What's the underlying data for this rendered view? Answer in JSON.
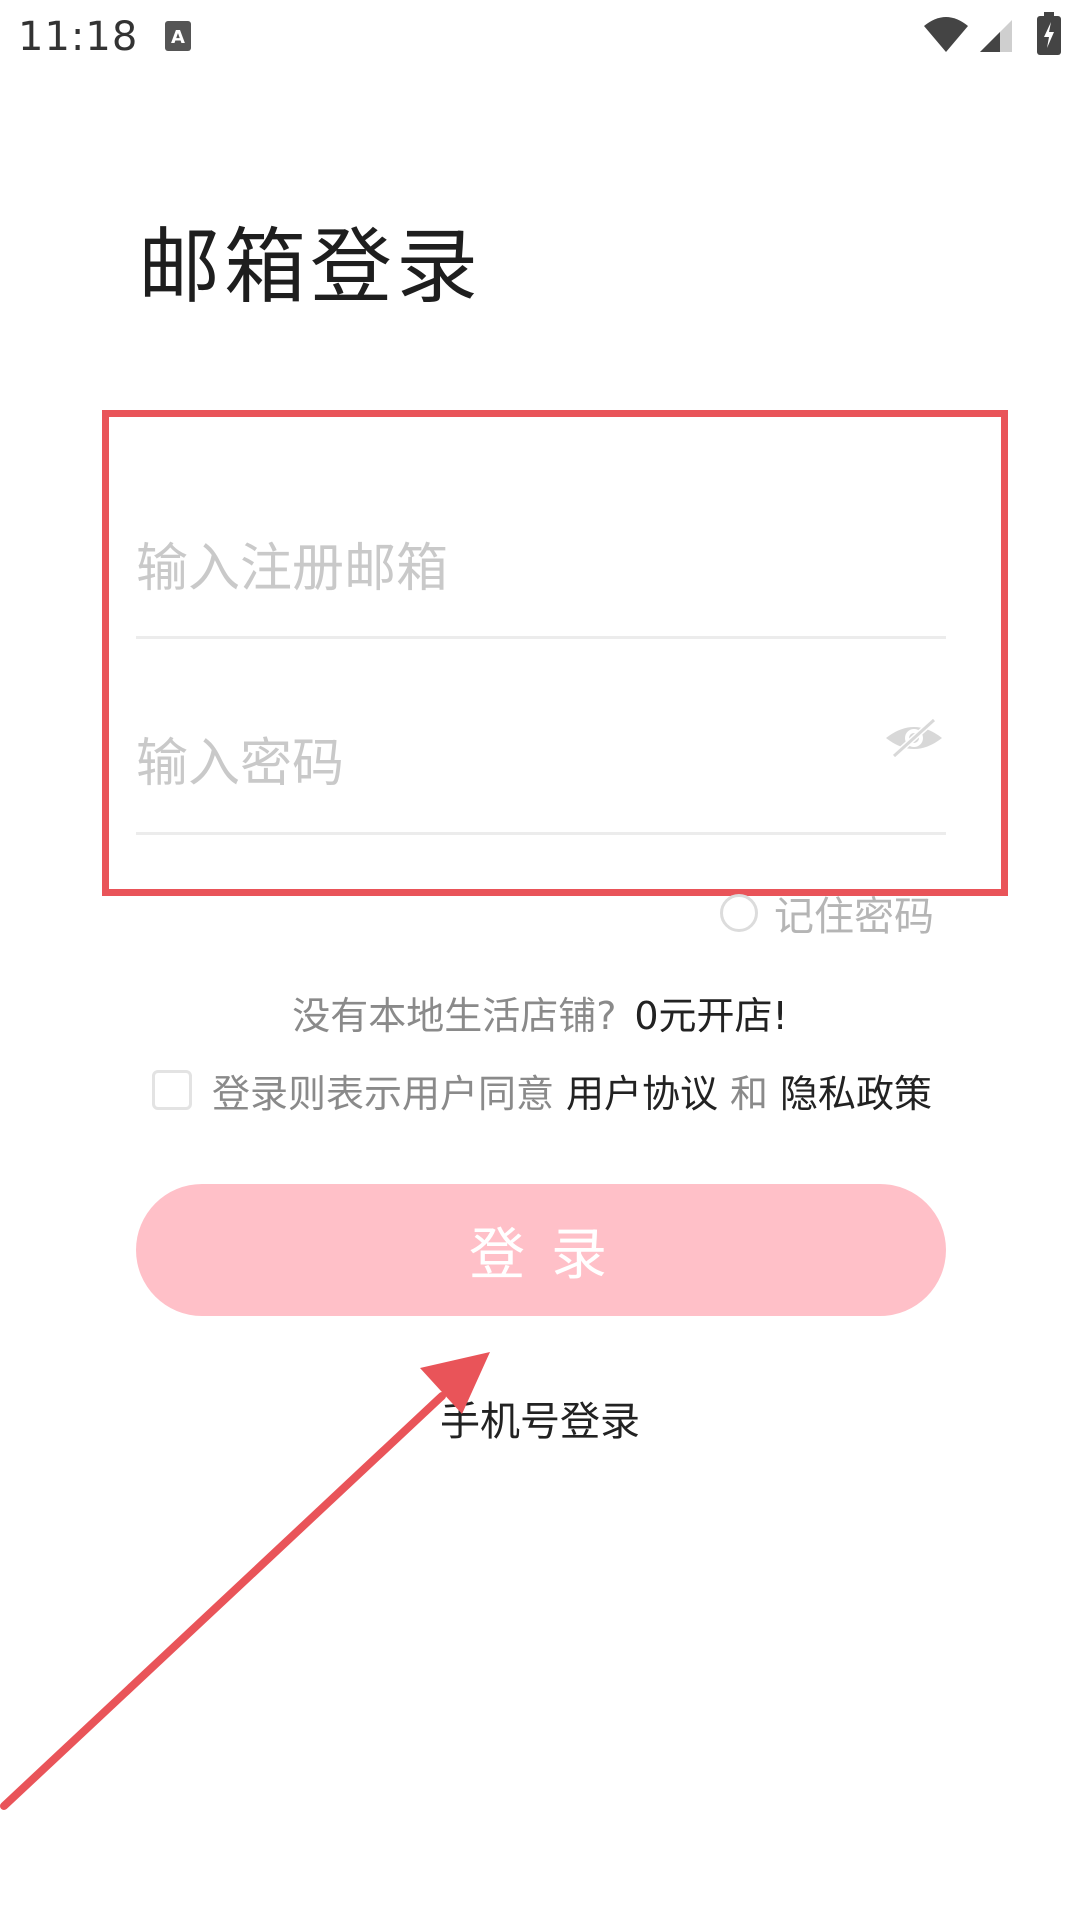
{
  "status_bar": {
    "time": "11:18",
    "icons": [
      "a-notification-icon",
      "wifi-icon",
      "signal-icon",
      "battery-icon"
    ]
  },
  "title": "邮箱登录",
  "email_field": {
    "value": "",
    "placeholder": "输入注册邮箱"
  },
  "password_field": {
    "value": "",
    "placeholder": "输入密码",
    "toggle_icon": "eye-hidden-icon"
  },
  "remember": {
    "label": "记住密码",
    "checked": false
  },
  "open_shop": {
    "question": "没有本地生活店铺?",
    "link": "0元开店!"
  },
  "agreement": {
    "checked": false,
    "prefix": "登录则表示用户同意",
    "user_agreement": "用户协议",
    "and": "和",
    "privacy_policy": "隐私政策"
  },
  "login_button": {
    "label": "登录"
  },
  "phone_login": {
    "label": "手机号登录"
  },
  "colors": {
    "highlight_box": "#e95459",
    "button_bg": "#ffc0c8",
    "arrow": "#e95459"
  }
}
